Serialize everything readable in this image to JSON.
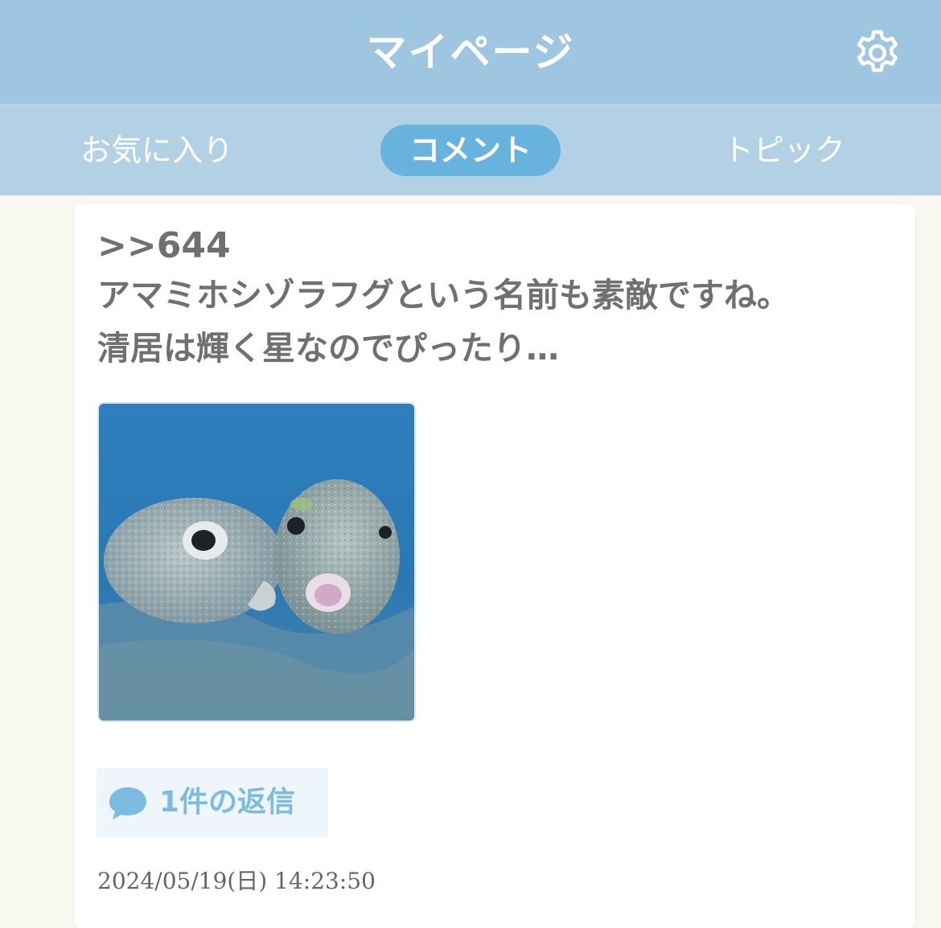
{
  "header": {
    "title": "マイページ",
    "settings_icon": "gear-icon",
    "background": "#9fc6e0"
  },
  "tabs": [
    {
      "label": "お気に入り",
      "active": false
    },
    {
      "label": "コメント",
      "active": true
    },
    {
      "label": "トピック",
      "active": false
    }
  ],
  "comment": {
    "ref": ">>644",
    "text": "アマミホシゾラフグという名前も素敵ですね。\n清居は輝く星なのでぴったり…",
    "image_subject": "pufferfish-photo",
    "reply": {
      "icon": "speech-bubble-icon",
      "label": "1件の返信"
    },
    "timestamp": "2024/05/19(日) 14:23:50"
  },
  "colors": {
    "accent": "#68b2de",
    "tab_bar": "#b2d1e5",
    "text": "#707070",
    "reply_text": "#7dbbe0"
  }
}
